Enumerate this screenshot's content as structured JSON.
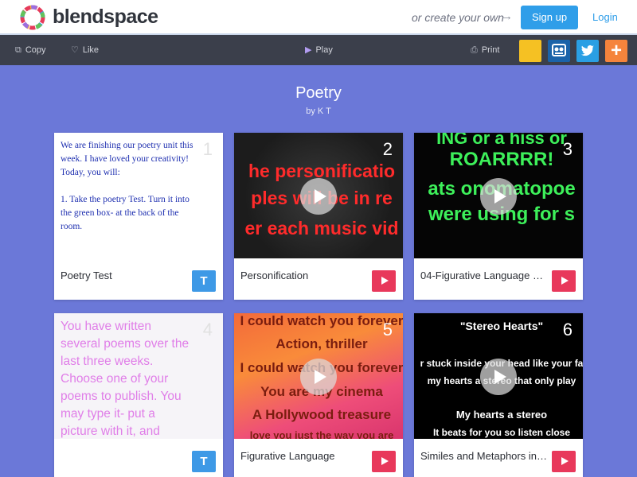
{
  "header": {
    "brand": "blendspace",
    "create_text": "or create your own",
    "arrow": "→",
    "signup_label": "Sign up",
    "login_label": "Login"
  },
  "toolbar": {
    "copy_label": "Copy",
    "like_label": "Like",
    "play_label": "Play",
    "print_label": "Print",
    "plus_label": "+"
  },
  "lesson": {
    "title": "Poetry",
    "byline": "by K T"
  },
  "cards": [
    {
      "number": "1",
      "caption": "Poetry Test",
      "badge": "T",
      "lines": [
        "We are finishing our poetry unit this",
        "week. I have loved your creativity!",
        "Today, you will:",
        "",
        "1. Take the poetry Test. Turn it into",
        "the green box- at the back of the",
        "room."
      ]
    },
    {
      "number": "2",
      "caption": "Personification",
      "lines": [
        "he personificatio",
        "ples will be in re",
        "er each music vid"
      ]
    },
    {
      "number": "3",
      "caption": "04-Figurative Language Ra...",
      "lines": [
        "ING or a hiss or",
        "ROARRRR!",
        "ats onomatopoe",
        "were using for s"
      ]
    },
    {
      "number": "4",
      "caption": "",
      "badge": "T",
      "lines": [
        "You have written",
        "several poems over the",
        "last three weeks.",
        "Choose one of your",
        "poems to publish. You",
        "may type it- put a",
        "picture with it, and"
      ]
    },
    {
      "number": "5",
      "caption": "Figurative Language",
      "lines": [
        "I could watch you forever",
        "Action, thriller",
        "I could watch you forever",
        "You are my cinema",
        "A Hollywood treasure",
        "love you just the way you are"
      ]
    },
    {
      "number": "6",
      "caption": "Similes and Metaphors in ...",
      "lines": [
        "\"Stereo Hearts\"",
        "r stuck inside your head like your fa",
        "my hearts a stereo that only play",
        "My hearts a stereo",
        "It beats for you so listen close"
      ]
    }
  ],
  "colors": {
    "background": "#6b78d8",
    "toolbar": "#3b3f4b",
    "accent_blue": "#2f9ee9",
    "video_red": "#e8385b",
    "text_badge_blue": "#3e99e6"
  },
  "icons": [
    "blendspace-logo-icon",
    "arrow-right-icon",
    "copy-icon",
    "heart-icon",
    "play-icon",
    "print-icon",
    "classroom-icon",
    "twitter-icon",
    "plus-icon"
  ]
}
